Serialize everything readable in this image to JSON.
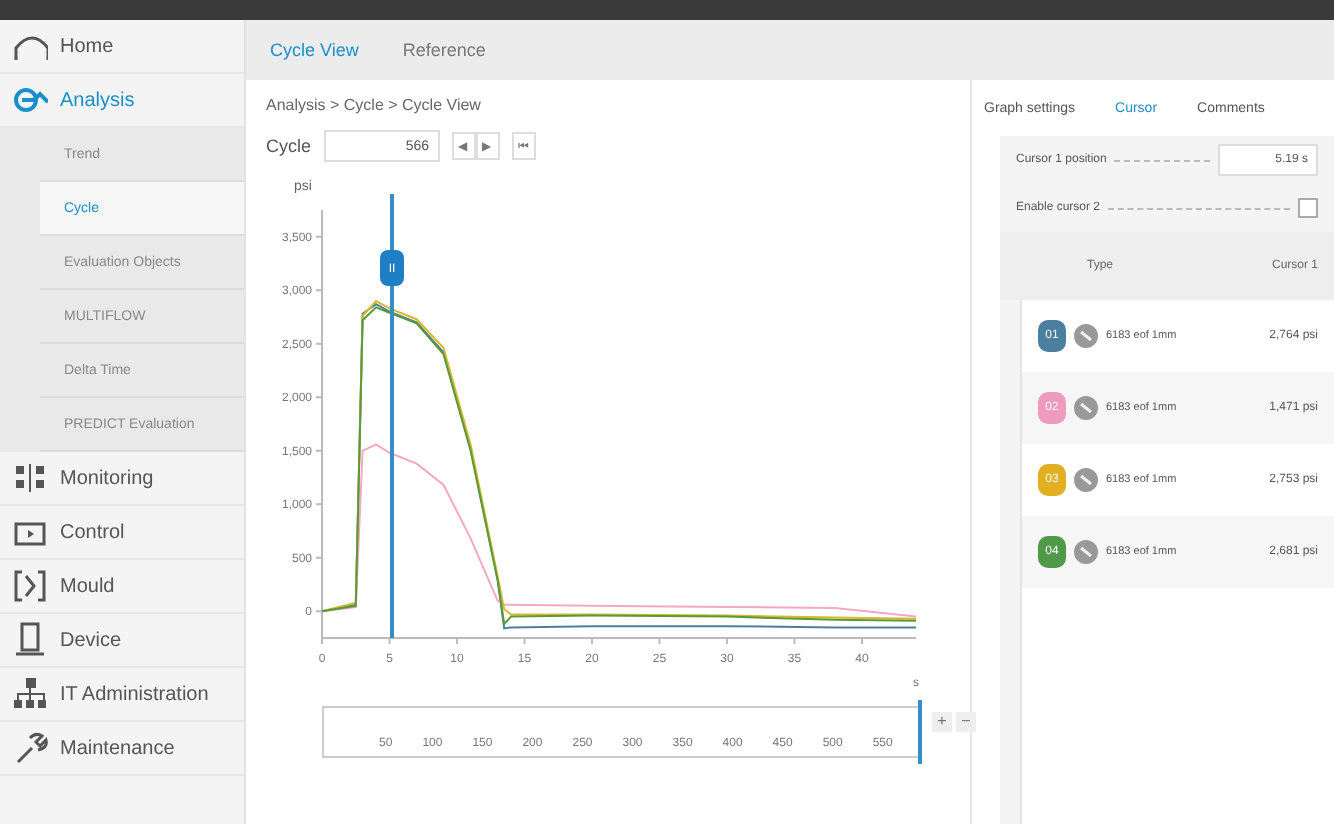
{
  "sidebar": {
    "items": [
      {
        "label": "Home",
        "kind": "home",
        "selected": false
      },
      {
        "label": "Analysis",
        "kind": "analysis",
        "selected": true,
        "children": [
          {
            "label": "Trend",
            "selected": false
          },
          {
            "label": "Cycle",
            "selected": true
          },
          {
            "label": "Evaluation Objects",
            "selected": false
          },
          {
            "label": "MULTIFLOW",
            "selected": false
          },
          {
            "label": "Delta Time",
            "selected": false
          },
          {
            "label": "PREDICT Evaluation",
            "selected": false
          }
        ]
      },
      {
        "label": "Monitoring",
        "kind": "monitoring",
        "selected": false
      },
      {
        "label": "Control",
        "kind": "control",
        "selected": false
      },
      {
        "label": "Mould",
        "kind": "mould",
        "selected": false
      },
      {
        "label": "Device",
        "kind": "device",
        "selected": false
      },
      {
        "label": "IT Administration",
        "kind": "network",
        "selected": false
      },
      {
        "label": "Maintenance",
        "kind": "maintenance",
        "selected": false
      }
    ]
  },
  "tabs": [
    {
      "label": "Cycle View",
      "selected": true
    },
    {
      "label": "Reference",
      "selected": false
    }
  ],
  "breadcrumb": "Analysis > Cycle > Cycle View",
  "cycle": {
    "label": "Cycle",
    "value": "566",
    "buttons": [
      "◀",
      "▶",
      "⏮"
    ]
  },
  "chart": {
    "cursor_label": "II",
    "chart_data": {
      "type": "line",
      "ylabel": "psi",
      "xlabel": "s",
      "x": [
        0,
        2.5,
        3,
        4,
        5,
        7,
        9,
        11,
        13,
        13.5,
        14,
        20,
        30,
        38,
        44
      ],
      "series": [
        {
          "color": "#4a7fa0",
          "values": [
            0,
            60,
            2780,
            2870,
            2800,
            2700,
            2420,
            1520,
            300,
            -160,
            -150,
            -140,
            -140,
            -150,
            -150
          ]
        },
        {
          "color": "#f4a8c4",
          "values": [
            0,
            40,
            1500,
            1560,
            1480,
            1380,
            1180,
            680,
            100,
            60,
            60,
            50,
            40,
            30,
            -50
          ]
        },
        {
          "color": "#d9b82e",
          "values": [
            0,
            80,
            2760,
            2900,
            2830,
            2730,
            2460,
            1560,
            330,
            20,
            -30,
            -30,
            -40,
            -60,
            -70
          ]
        },
        {
          "color": "#5a9a3a",
          "values": [
            0,
            50,
            2720,
            2840,
            2790,
            2690,
            2400,
            1500,
            290,
            -120,
            -50,
            -40,
            -50,
            -80,
            -90
          ]
        }
      ],
      "xlim": [
        0,
        44
      ],
      "ylim": [
        -250,
        3750
      ],
      "xticks": [
        0,
        5,
        10,
        15,
        20,
        25,
        30,
        35,
        40
      ],
      "yticks": [
        {
          "value": 0,
          "label": "0"
        },
        {
          "value": 500,
          "label": "500"
        },
        {
          "value": 1000,
          "label": "1,000"
        },
        {
          "value": 1500,
          "label": "1,500"
        },
        {
          "value": 2000,
          "label": "2,000"
        },
        {
          "value": 2500,
          "label": "2,500"
        },
        {
          "value": 3000,
          "label": "3,000"
        },
        {
          "value": 3500,
          "label": "3,500"
        }
      ]
    }
  },
  "range": {
    "labels": [
      "50",
      "100",
      "150",
      "200",
      "250",
      "300",
      "350",
      "400",
      "450",
      "500",
      "550"
    ],
    "plus": "+",
    "minus": "−",
    "level": 1
  },
  "panel": {
    "tabs": [
      {
        "label": "Graph settings",
        "selected": false
      },
      {
        "label": "Cursor",
        "selected": true
      },
      {
        "label": "Comments",
        "selected": false
      }
    ],
    "cursor_position": {
      "label": "Cursor 1 position",
      "value": "5.19 s"
    },
    "enable_cursor2": {
      "label": "Enable cursor 2",
      "checked": false
    },
    "columns": [
      "Type",
      "Cursor 1"
    ],
    "rows": [
      {
        "badge": "01",
        "color": "#4a7fa0",
        "type": "6183 eof 1mm",
        "value": "2,764 psi"
      },
      {
        "badge": "02",
        "color": "#f09ac0",
        "type": "6183 eof 1mm",
        "value": "1,471 psi"
      },
      {
        "badge": "03",
        "color": "#e0b020",
        "type": "6183 eof 1mm",
        "value": "2,753 psi"
      },
      {
        "badge": "04",
        "color": "#4f9a48",
        "type": "6183 eof 1mm",
        "value": "2,681 psi"
      }
    ]
  }
}
